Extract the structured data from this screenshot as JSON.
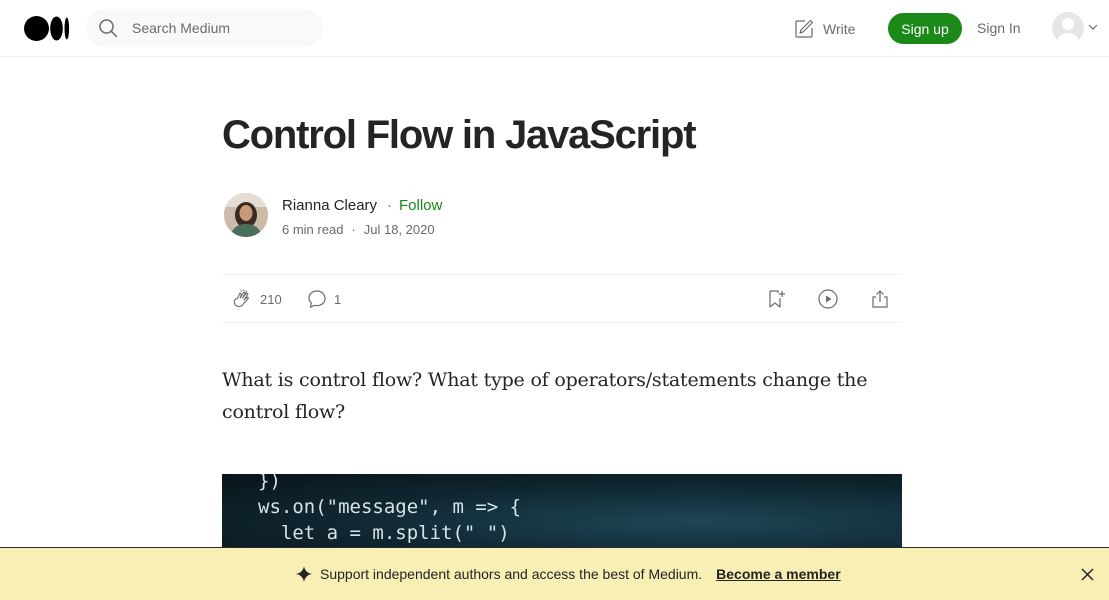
{
  "header": {
    "logo_name": "medium-logo",
    "search_placeholder": "Search Medium",
    "write_label": "Write",
    "signup_label": "Sign up",
    "signin_label": "Sign In"
  },
  "article": {
    "title": "Control Flow in JavaScript",
    "author": "Rianna Cleary",
    "follow_separator": "·",
    "follow_label": "Follow",
    "read_time": "6 min read",
    "meta_separator": "·",
    "date": "Jul 18, 2020",
    "claps": "210",
    "comments": "1",
    "intro": "What is control flow? What type of operators/statements change the control flow?",
    "code_lines": [
      "})",
      "ws.on(\"message\", m => {",
      "  let a = m.split(\" \")"
    ]
  },
  "banner": {
    "text": "Support independent authors and access the best of Medium.",
    "link": "Become a member"
  },
  "colors": {
    "brand_green": "#1a8917",
    "banner_bg": "#f8efb4",
    "text": "#242424",
    "muted": "#6b6b6b"
  }
}
